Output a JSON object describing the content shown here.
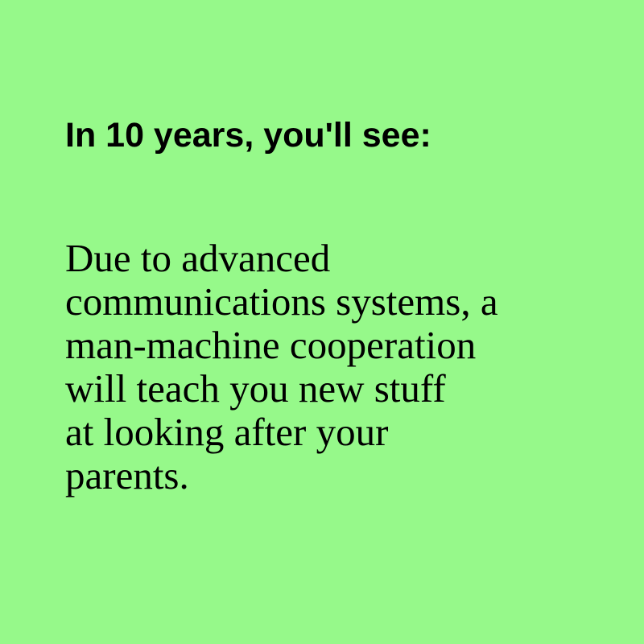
{
  "card": {
    "background": "#96f98a",
    "text_color": "#000000",
    "heading": "In 10 years, you'll see:",
    "body_lines": [
      "Due to advanced",
      "communications systems, a",
      "man-machine cooperation",
      "will teach you new stuff",
      "at looking after your",
      "parents."
    ]
  }
}
